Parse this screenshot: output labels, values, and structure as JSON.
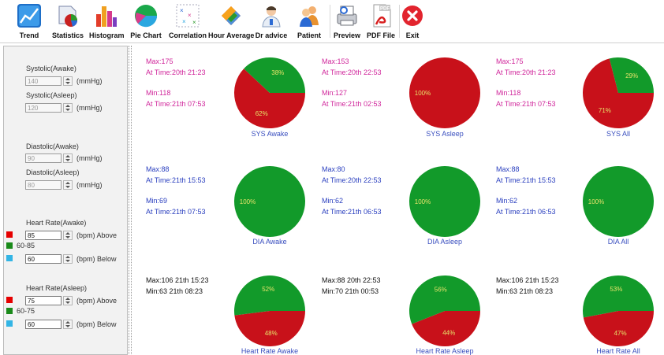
{
  "toolbar": {
    "buttons": [
      {
        "label": "Trend",
        "icon": "trend-icon"
      },
      {
        "label": "Statistics",
        "icon": "statistics-icon"
      },
      {
        "label": "Histogram",
        "icon": "histogram-icon"
      },
      {
        "label": "Pie Chart",
        "icon": "pie-chart-icon"
      },
      {
        "label": "Correlation",
        "icon": "correlation-icon"
      },
      {
        "label": "Hour Average",
        "icon": "hour-average-icon"
      },
      {
        "label": "Dr advice",
        "icon": "doctor-icon"
      },
      {
        "label": "Patient",
        "icon": "patient-icon"
      },
      {
        "label": "Preview",
        "icon": "preview-icon"
      },
      {
        "label": "PDF File",
        "icon": "pdf-icon"
      },
      {
        "label": "Exit",
        "icon": "exit-icon"
      }
    ],
    "pdf_badge": "PDF"
  },
  "settings": {
    "systolic_awake": {
      "label": "Systolic(Awake)",
      "value": "140",
      "unit": "(mmHg)"
    },
    "systolic_asleep": {
      "label": "Systolic(Asleep)",
      "value": "120",
      "unit": "(mmHg)"
    },
    "diastolic_awake": {
      "label": "Diastolic(Awake)",
      "value": "90",
      "unit": "(mmHg)"
    },
    "diastolic_asleep": {
      "label": "Diastolic(Asleep)",
      "value": "80",
      "unit": "(mmHg)"
    },
    "hr_awake": {
      "label": "Heart Rate(Awake)",
      "above_value": "85",
      "above_text": "(bpm) Above",
      "range_text": "60-85",
      "below_value": "60",
      "below_text": "(bpm) Below"
    },
    "hr_asleep": {
      "label": "Heart Rate(Asleep)",
      "above_value": "75",
      "above_text": "(bpm) Above",
      "range_text": "60-75",
      "below_value": "60",
      "below_text": "(bpm) Below"
    },
    "colors": {
      "above": "#e60000",
      "normal": "#1a8a1a",
      "below": "#33b5e5"
    }
  },
  "colors": {
    "red": "#c8111a",
    "green": "#129a2a",
    "stats_sys": "#d0269b",
    "stats_dia": "#2a3fbf",
    "caption": "#3a4fbf"
  },
  "stats": {
    "sys_awake": {
      "max": "Max:175",
      "max_time": "At Time:20th 21:23",
      "min": "Min:118",
      "min_time": "At Time:21th 07:53"
    },
    "sys_asleep": {
      "max": "Max:153",
      "max_time": "At Time:20th 22:53",
      "min": "Min:127",
      "min_time": "At Time:21th 02:53"
    },
    "sys_all": {
      "max": "Max:175",
      "max_time": "At Time:20th 21:23",
      "min": "Min:118",
      "min_time": "At Time:21th 07:53"
    },
    "dia_awake": {
      "max": "Max:88",
      "max_time": "At Time:21th 15:53",
      "min": "Min:69",
      "min_time": "At Time:21th 07:53"
    },
    "dia_asleep": {
      "max": "Max:80",
      "max_time": "At Time:20th 22:53",
      "min": "Min:62",
      "min_time": "At Time:21th 06:53"
    },
    "dia_all": {
      "max": "Max:88",
      "max_time": "At Time:21th 15:53",
      "min": "Min:62",
      "min_time": "At Time:21th 06:53"
    },
    "hr_awake": {
      "max": "Max:106  21th 15:23",
      "min": "Min:63  21th 08:23"
    },
    "hr_asleep": {
      "max": "Max:88  20th 22:53",
      "min": "Min:70  21th 00:53"
    },
    "hr_all": {
      "max": "Max:106  21th 15:23",
      "min": "Min:63  21th 08:23"
    }
  },
  "chart_data": [
    {
      "type": "pie",
      "title": "SYS   Awake",
      "slices": [
        {
          "label": "62%",
          "value": 62,
          "color": "red"
        },
        {
          "label": "38%",
          "value": 38,
          "color": "green"
        }
      ]
    },
    {
      "type": "pie",
      "title": "SYS   Asleep",
      "slices": [
        {
          "label": "100%",
          "value": 100,
          "color": "red"
        }
      ]
    },
    {
      "type": "pie",
      "title": "SYS   All",
      "slices": [
        {
          "label": "71%",
          "value": 71,
          "color": "red"
        },
        {
          "label": "29%",
          "value": 29,
          "color": "green"
        }
      ]
    },
    {
      "type": "pie",
      "title": "DIA   Awake",
      "slices": [
        {
          "label": "100%",
          "value": 100,
          "color": "green"
        }
      ]
    },
    {
      "type": "pie",
      "title": "DIA   Asleep",
      "slices": [
        {
          "label": "100%",
          "value": 100,
          "color": "green"
        }
      ]
    },
    {
      "type": "pie",
      "title": "DIA   All",
      "slices": [
        {
          "label": "100%",
          "value": 100,
          "color": "green"
        }
      ]
    },
    {
      "type": "pie",
      "title": "Heart Rate   Awake",
      "slices": [
        {
          "label": "48%",
          "value": 48,
          "color": "red"
        },
        {
          "label": "52%",
          "value": 52,
          "color": "green"
        }
      ]
    },
    {
      "type": "pie",
      "title": "Heart Rate   Asleep",
      "slices": [
        {
          "label": "44%",
          "value": 44,
          "color": "red"
        },
        {
          "label": "56%",
          "value": 56,
          "color": "green"
        }
      ]
    },
    {
      "type": "pie",
      "title": "Heart Rate   All",
      "slices": [
        {
          "label": "47%",
          "value": 47,
          "color": "red"
        },
        {
          "label": "53%",
          "value": 53,
          "color": "green"
        }
      ]
    }
  ]
}
